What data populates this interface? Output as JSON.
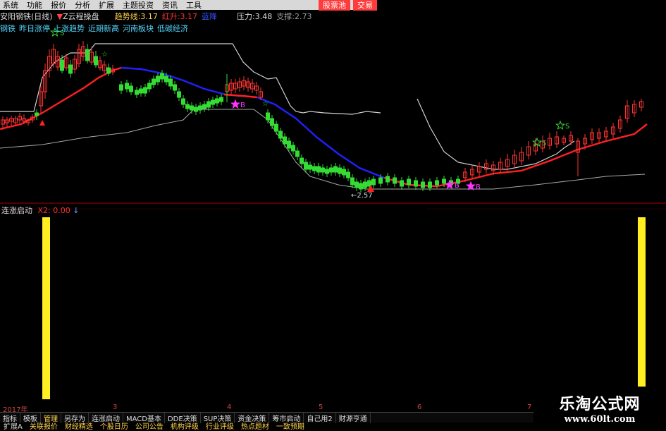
{
  "menu": {
    "items": [
      "系统",
      "功能",
      "报价",
      "分析",
      "扩展",
      "主题投资",
      "资讯",
      "工具"
    ],
    "stock_btn": "股票池",
    "trade_btn": "交易"
  },
  "info": {
    "stock_name": "安阳钢铁(日线)",
    "indicator": "Z云程操盘",
    "trend_label": "趋势线:",
    "trend_value": "3.17",
    "red_label": "红升:",
    "red_value": "3.17",
    "blue_label": "蓝降",
    "pressure_label": "压力:",
    "pressure_value": "3.48",
    "support_label": "支撑:",
    "support_value": "2.73"
  },
  "concepts": [
    "钢铁",
    "昨日涨停",
    "上涨趋势",
    "近期新高",
    "河南板块",
    "低碳经济"
  ],
  "chart": {
    "low_label": "2.57",
    "star_labels": [
      "B",
      "S",
      "S",
      "S",
      "B",
      "B"
    ]
  },
  "lower": {
    "name": "连涨启动",
    "x2_label": "X2:",
    "x2_value": "0.00"
  },
  "dates": [
    "2017年",
    "3",
    "4",
    "5",
    "6",
    "7"
  ],
  "tabs": [
    "指标",
    "模板",
    "管理",
    "另存为",
    "连涨启动",
    "MACD基本",
    "DDE决策",
    "SUP决策",
    "资金决策",
    "筹市启动",
    "自己用2",
    "财源亨通"
  ],
  "active_tab": "管理",
  "bottom_tabs": [
    "扩展A",
    "关联报价",
    "财经精选",
    "个股日历",
    "公司公告",
    "机构评级",
    "行业评级",
    "热点题材",
    "一致预期"
  ],
  "watermark": {
    "title": "乐淘公式网",
    "url": "www.60lt.com"
  },
  "colors": {
    "up": "#ff3333",
    "down": "#33dd33",
    "trend_red": "#ff2020",
    "trend_blue": "#2020ff",
    "pressure": "#d0d0d0",
    "bar": "#ffee22",
    "bg": "#000000"
  }
}
